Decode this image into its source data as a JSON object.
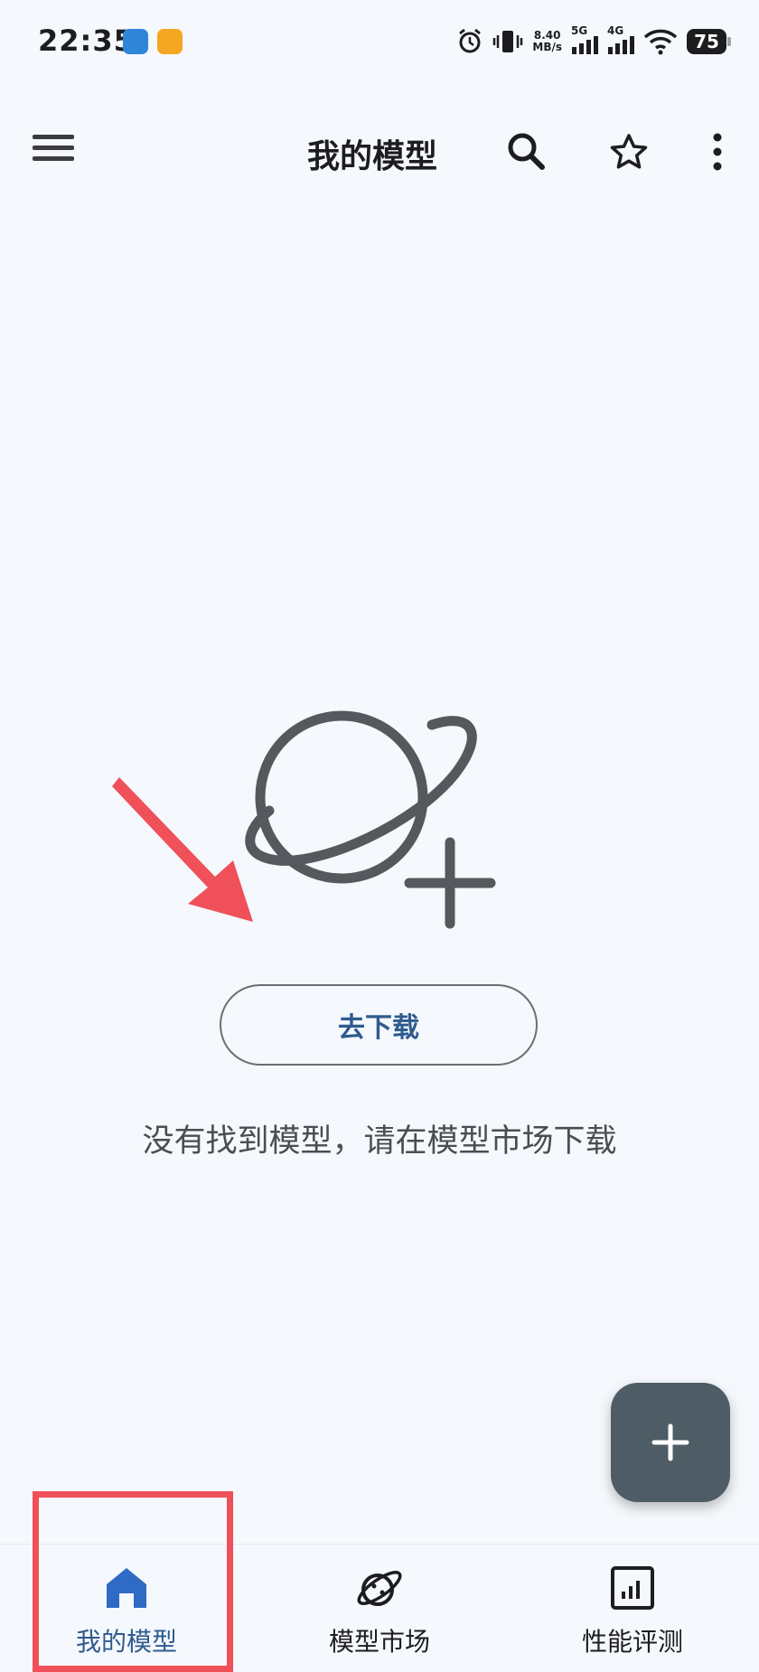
{
  "status_bar": {
    "time": "22:35",
    "net_speed_value": "8.40",
    "net_speed_unit": "MB/s",
    "net_5g": "5G",
    "net_4g": "4G",
    "battery": "75"
  },
  "app_bar": {
    "title": "我的模型",
    "icons": [
      "menu-icon",
      "search-icon",
      "star-icon",
      "more-vert-icon"
    ]
  },
  "empty_state": {
    "button_label": "去下载",
    "message": "没有找到模型，请在模型市场下载"
  },
  "bottom_nav": {
    "items": [
      {
        "label": "我的模型",
        "icon": "home-icon",
        "active": true
      },
      {
        "label": "模型市场",
        "icon": "planet-icon",
        "active": false
      },
      {
        "label": "性能评测",
        "icon": "bar-chart-icon",
        "active": false
      }
    ]
  },
  "colors": {
    "background": "#f5f8fc",
    "accent": "#2f5b8f",
    "fab": "#4e5c65",
    "annotation": "#f0505a"
  }
}
